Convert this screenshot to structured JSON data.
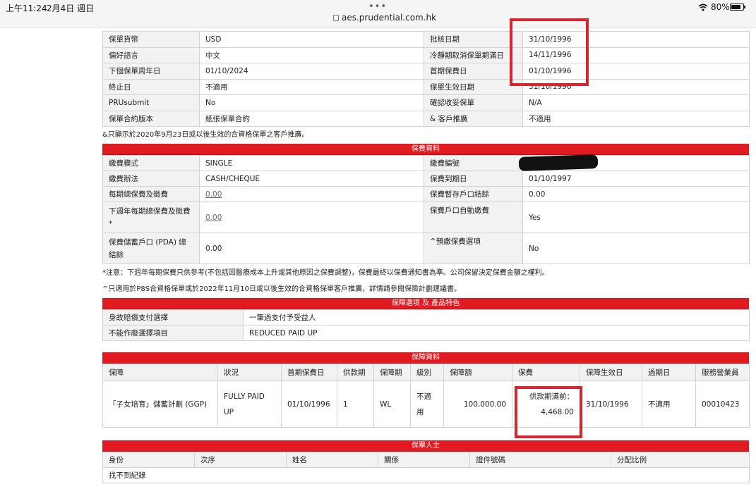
{
  "status_bar": {
    "time": "上午11:24",
    "date": "2月4日 週日",
    "dots": "•••",
    "url": "aes.prudential.com.hk",
    "battery": "80%",
    "battery_level": 0.8
  },
  "policy_info": {
    "rows": [
      {
        "l1": "保單貨幣",
        "v1": "USD",
        "l2": "批核日期",
        "v2": "31/10/1996"
      },
      {
        "l1": "偏好語言",
        "v1": "中文",
        "l2": "冷靜期取消保單期滿日",
        "v2": "14/11/1996"
      },
      {
        "l1": "下個保單周年日",
        "v1": "01/10/2024",
        "l2": "首期保費日",
        "v2": "01/10/1996"
      },
      {
        "l1": "終止日",
        "v1": "不適用",
        "l2": "保單生效日期",
        "v2": "31/10/1996"
      },
      {
        "l1": "PRUsubmit",
        "v1": "No",
        "l2": "確認收妥保單",
        "v2": "N/A"
      },
      {
        "l1": "保單合約版本",
        "v1": "紙張保單合約",
        "l2": "& 客戶推廣",
        "v2": "不適用"
      }
    ],
    "note": "&只顯示於2020年9月23日或以後生效的合資格保單之客戶推廣。"
  },
  "premium_info": {
    "title": "保費資料",
    "rows": [
      {
        "l1": "繳費模式",
        "v1": "SINGLE",
        "l2": "繳費編號",
        "v2": ""
      },
      {
        "l1": "繳費辦法",
        "v1": "CASH/CHEQUE",
        "l2": "保費到期日",
        "v2": "01/10/1997"
      },
      {
        "l1": "每期總保費及徵費",
        "v1": "0.00",
        "l2": "保費暫存戶口結餘",
        "v2": "0.00"
      },
      {
        "l1": "下週年每期總保費及徵費*",
        "v1": "0.00",
        "l2": "保費戶口自動繳費",
        "v2": "Yes"
      },
      {
        "l1": "保費儲蓄戶口 (PDA) 總結餘",
        "v1": "0.00",
        "l2": "^預繳保費選項",
        "v2": "No"
      }
    ],
    "note1": "*注意：下週年每期保費只供參考(不包括因醫療成本上升或其他原因之保費調整)，保費最終以保費通知書為準。公司保留決定保費金額之權利。",
    "note2": "^只適用於P8S合資格保單或於2022年11月10日或以後生效的合資格保單客戶推廣，詳情請參閱保險計劃建議書。"
  },
  "options": {
    "title": "保障選項 及 產品特色",
    "rows": [
      {
        "label": "身故賠償支付選擇",
        "value": "一筆過支付予受益人"
      },
      {
        "label": "不能作廢選擇項目",
        "value": "REDUCED PAID UP"
      }
    ]
  },
  "coverage": {
    "title": "保障資料",
    "headers": [
      "保障",
      "狀況",
      "首期保費日",
      "供款期",
      "保障期",
      "級別",
      "保障額",
      "保費",
      "保障生效日",
      "過期日",
      "服務營業員"
    ],
    "row": {
      "plan": "「子女培育」儲蓄計劃 (GGP)",
      "status": "FULLY PAID UP",
      "first_premium": "01/10/1996",
      "pay_term": "1",
      "cover_term": "WL",
      "class": "不適用",
      "sum": "100,000.00",
      "premium_label": "供款期滿前：",
      "premium_value": "4,468.00",
      "effective": "31/10/1996",
      "expiry": "不適用",
      "agent": "00010423"
    }
  },
  "beneficiary": {
    "title": "保單人士",
    "headers": [
      "身份",
      "次序",
      "姓名",
      "關係",
      "證件號碼",
      "分配比例"
    ],
    "empty": "找不到紀錄"
  }
}
